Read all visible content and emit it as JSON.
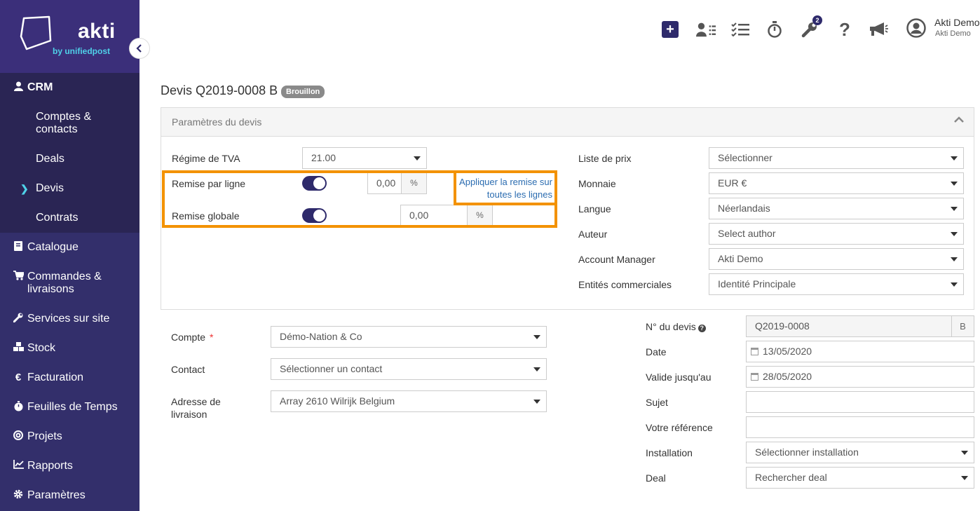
{
  "brand": {
    "name": "akti",
    "tagline": "by unifiedpost",
    "primary": "#2e2a6b",
    "accent": "#4fd1e8",
    "highlight": "#f39200"
  },
  "sidebar": {
    "crm": {
      "label": "CRM",
      "icon": "user-icon"
    },
    "crm_items": [
      {
        "label": "Comptes &\ncontacts"
      },
      {
        "label": "Deals"
      },
      {
        "label": "Devis",
        "active": true
      },
      {
        "label": "Contrats"
      }
    ],
    "items": [
      {
        "label": "Catalogue",
        "icon": "book-icon"
      },
      {
        "label": "Commandes &\nlivraisons",
        "icon": "cart-icon"
      },
      {
        "label": "Services sur site",
        "icon": "wrench-icon"
      },
      {
        "label": "Stock",
        "icon": "cubes-icon"
      },
      {
        "label": "Facturation",
        "icon": "euro-icon"
      },
      {
        "label": "Feuilles de Temps",
        "icon": "stopwatch-icon"
      },
      {
        "label": "Projets",
        "icon": "target-icon"
      },
      {
        "label": "Rapports",
        "icon": "chart-icon"
      },
      {
        "label": "Paramètres",
        "icon": "gear-icon"
      }
    ]
  },
  "topbar": {
    "tools_badge": "2",
    "user_name": "Akti Demo",
    "user_company": "Akti Demo"
  },
  "page": {
    "title": "Devis Q2019-0008 B",
    "status": "Brouillon"
  },
  "panel": {
    "title": "Paramètres du devis",
    "vat_label": "Régime de TVA",
    "vat_value": "21.00",
    "line_discount_label": "Remise par ligne",
    "line_discount_value": "0,00",
    "line_discount_unit": "%",
    "apply_link": "Appliquer la remise sur toutes les lignes",
    "global_discount_label": "Remise globale",
    "global_discount_value": "0,00",
    "global_discount_unit": "%",
    "right": [
      {
        "label": "Liste de prix",
        "value": "Sélectionner"
      },
      {
        "label": "Monnaie",
        "value": "EUR €"
      },
      {
        "label": "Langue",
        "value": "Néerlandais"
      },
      {
        "label": "Auteur",
        "value": "Select author"
      },
      {
        "label": "Account Manager",
        "value": "Akti Demo"
      },
      {
        "label": "Entités commerciales",
        "value": "Identité Principale"
      }
    ]
  },
  "form": {
    "account_label": "Compte",
    "account_required": "*",
    "account_value": "Démo-Nation & Co",
    "contact_label": "Contact",
    "contact_value": "Sélectionner un contact",
    "address_label": "Adresse de\nlivraison",
    "address_value": "Array 2610 Wilrijk Belgium",
    "quote_no_label": "N° du devis",
    "quote_no_value": "Q2019-0008",
    "quote_no_suffix": "B",
    "date_label": "Date",
    "date_value": "13/05/2020",
    "valid_label": "Valide jusqu'au",
    "valid_value": "28/05/2020",
    "subject_label": "Sujet",
    "subject_value": "",
    "ref_label": "Votre référence",
    "ref_value": "",
    "installation_label": "Installation",
    "installation_value": "Sélectionner installation",
    "deal_label": "Deal",
    "deal_value": "Rechercher deal"
  }
}
